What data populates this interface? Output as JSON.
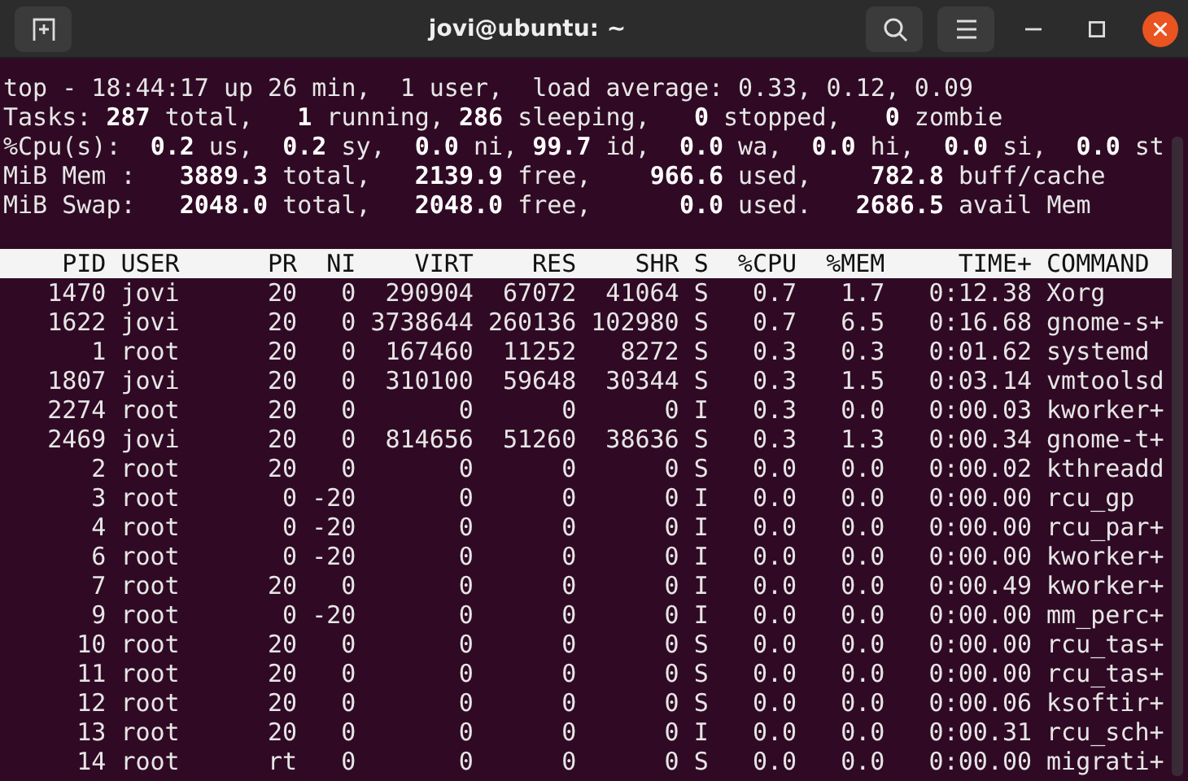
{
  "window": {
    "title": "jovi@ubuntu: ~"
  },
  "summary": [
    "top - 18:44:17 up 26 min,  1 user,  load average: 0.33, 0.12, 0.09",
    "Tasks: **287** total,   **1** running, **286** sleeping,   **0** stopped,   **0** zombie",
    "%Cpu(s):  **0.2** us,  **0.2** sy,  **0.0** ni, **99.7** id,  **0.0** wa,  **0.0** hi,  **0.0** si,  **0.0** st",
    "MiB Mem :   **3889.3** total,   **2139.9** free,    **966.6** used,    **782.8** buff/cache",
    "MiB Swap:   **2048.0** total,   **2048.0** free,      **0.0** used.   **2686.5** avail Mem"
  ],
  "table": {
    "columns": [
      "PID",
      "USER",
      "PR",
      "NI",
      "VIRT",
      "RES",
      "SHR",
      "S",
      "%CPU",
      "%MEM",
      "TIME+",
      "COMMAND"
    ],
    "rows": [
      [
        "1470",
        "jovi",
        "20",
        "0",
        "290904",
        "67072",
        "41064",
        "S",
        "0.7",
        "1.7",
        "0:12.38",
        "Xorg"
      ],
      [
        "1622",
        "jovi",
        "20",
        "0",
        "3738644",
        "260136",
        "102980",
        "S",
        "0.7",
        "6.5",
        "0:16.68",
        "gnome-s+"
      ],
      [
        "1",
        "root",
        "20",
        "0",
        "167460",
        "11252",
        "8272",
        "S",
        "0.3",
        "0.3",
        "0:01.62",
        "systemd"
      ],
      [
        "1807",
        "jovi",
        "20",
        "0",
        "310100",
        "59648",
        "30344",
        "S",
        "0.3",
        "1.5",
        "0:03.14",
        "vmtoolsd"
      ],
      [
        "2274",
        "root",
        "20",
        "0",
        "0",
        "0",
        "0",
        "I",
        "0.3",
        "0.0",
        "0:00.03",
        "kworker+"
      ],
      [
        "2469",
        "jovi",
        "20",
        "0",
        "814656",
        "51260",
        "38636",
        "S",
        "0.3",
        "1.3",
        "0:00.34",
        "gnome-t+"
      ],
      [
        "2",
        "root",
        "20",
        "0",
        "0",
        "0",
        "0",
        "S",
        "0.0",
        "0.0",
        "0:00.02",
        "kthreadd"
      ],
      [
        "3",
        "root",
        "0",
        "-20",
        "0",
        "0",
        "0",
        "I",
        "0.0",
        "0.0",
        "0:00.00",
        "rcu_gp"
      ],
      [
        "4",
        "root",
        "0",
        "-20",
        "0",
        "0",
        "0",
        "I",
        "0.0",
        "0.0",
        "0:00.00",
        "rcu_par+"
      ],
      [
        "6",
        "root",
        "0",
        "-20",
        "0",
        "0",
        "0",
        "I",
        "0.0",
        "0.0",
        "0:00.00",
        "kworker+"
      ],
      [
        "7",
        "root",
        "20",
        "0",
        "0",
        "0",
        "0",
        "I",
        "0.0",
        "0.0",
        "0:00.49",
        "kworker+"
      ],
      [
        "9",
        "root",
        "0",
        "-20",
        "0",
        "0",
        "0",
        "I",
        "0.0",
        "0.0",
        "0:00.00",
        "mm_perc+"
      ],
      [
        "10",
        "root",
        "20",
        "0",
        "0",
        "0",
        "0",
        "S",
        "0.0",
        "0.0",
        "0:00.00",
        "rcu_tas+"
      ],
      [
        "11",
        "root",
        "20",
        "0",
        "0",
        "0",
        "0",
        "S",
        "0.0",
        "0.0",
        "0:00.00",
        "rcu_tas+"
      ],
      [
        "12",
        "root",
        "20",
        "0",
        "0",
        "0",
        "0",
        "S",
        "0.0",
        "0.0",
        "0:00.06",
        "ksoftir+"
      ],
      [
        "13",
        "root",
        "20",
        "0",
        "0",
        "0",
        "0",
        "I",
        "0.0",
        "0.0",
        "0:00.31",
        "rcu_sch+"
      ],
      [
        "14",
        "root",
        "rt",
        "0",
        "0",
        "0",
        "0",
        "S",
        "0.0",
        "0.0",
        "0:00.00",
        "migrati+"
      ]
    ]
  }
}
